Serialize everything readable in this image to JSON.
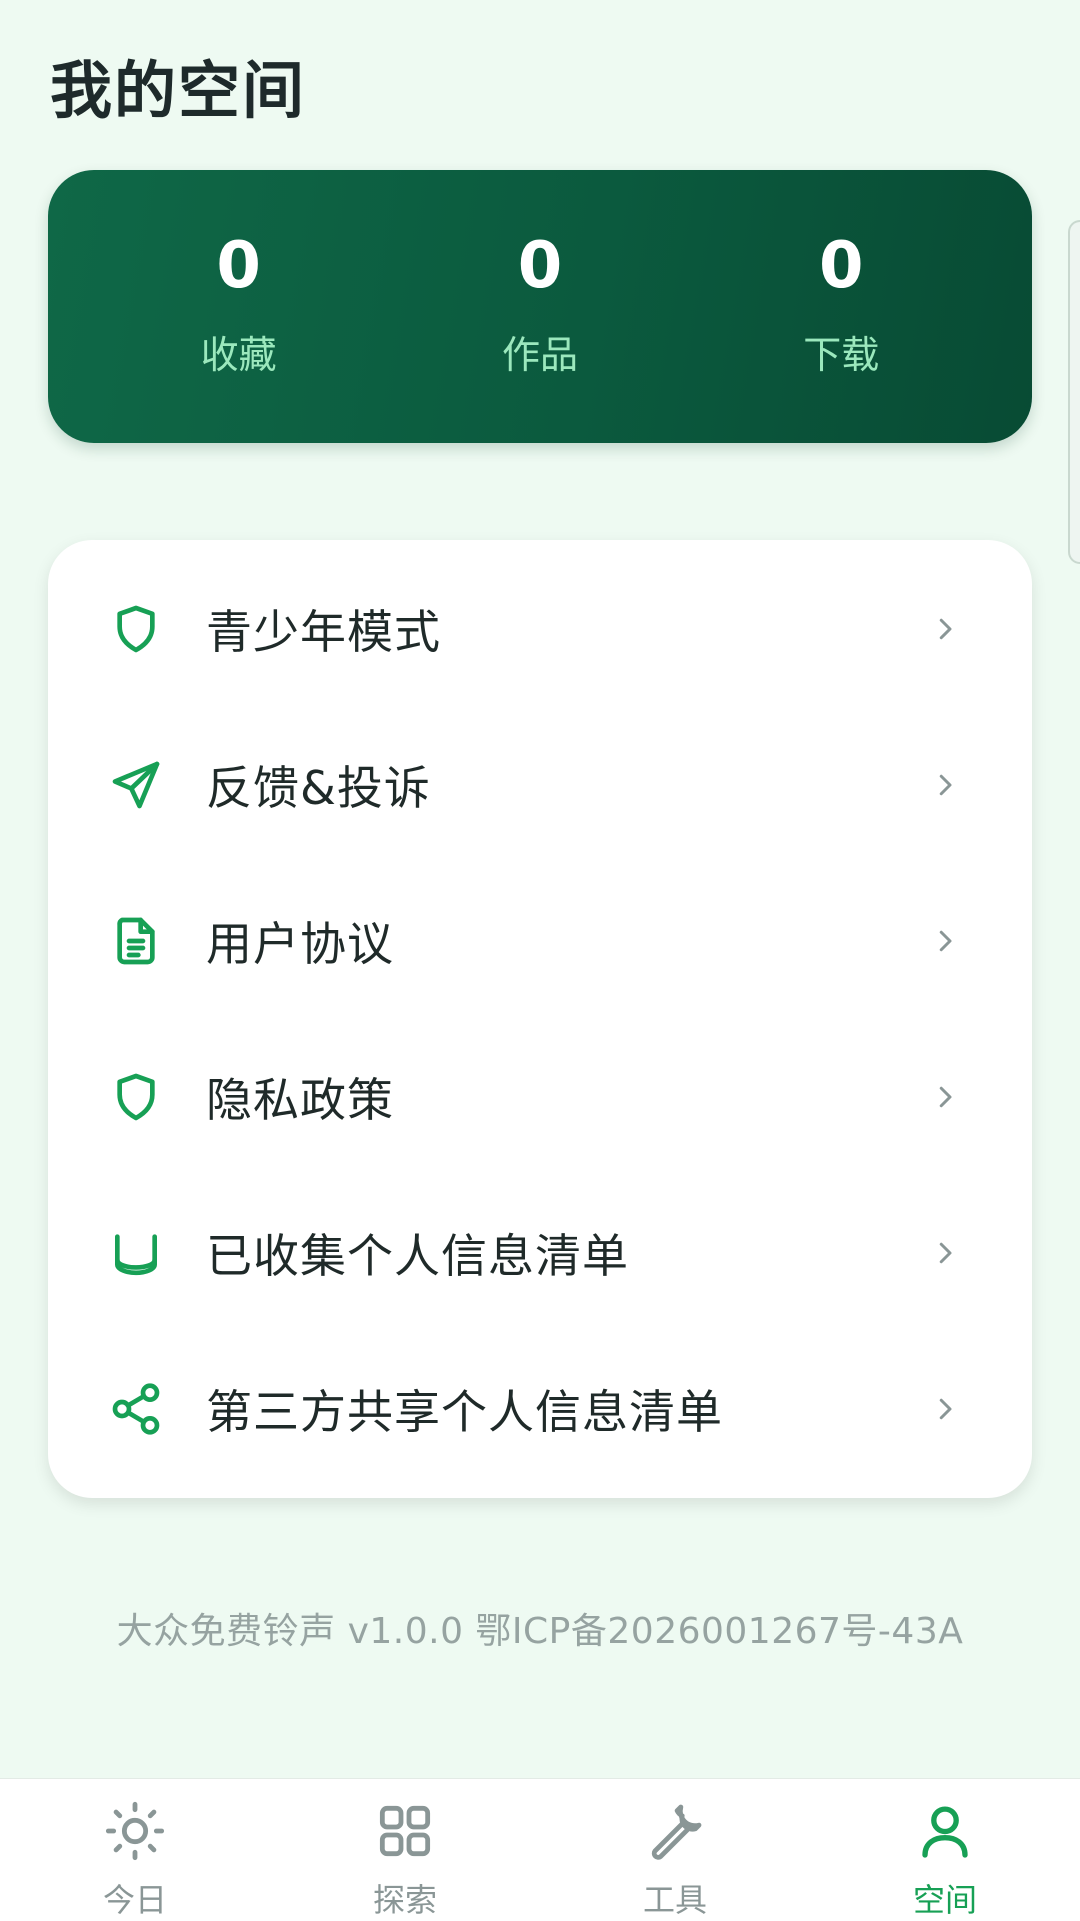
{
  "page": {
    "title": "我的空间"
  },
  "stats": [
    {
      "value": "0",
      "label": "收藏"
    },
    {
      "value": "0",
      "label": "作品"
    },
    {
      "value": "0",
      "label": "下载"
    }
  ],
  "menu": {
    "items": [
      {
        "label": "青少年模式",
        "icon": "shield-icon"
      },
      {
        "label": "反馈&投诉",
        "icon": "send-icon"
      },
      {
        "label": "用户协议",
        "icon": "document-icon"
      },
      {
        "label": "隐私政策",
        "icon": "shield-icon"
      },
      {
        "label": "已收集个人信息清单",
        "icon": "database-icon"
      },
      {
        "label": "第三方共享个人信息清单",
        "icon": "share-icon"
      }
    ]
  },
  "footer": {
    "text": "大众免费铃声 v1.0.0 鄂ICP备2026001267号-43A"
  },
  "nav": {
    "items": [
      {
        "label": "今日",
        "icon": "sun-icon",
        "active": false
      },
      {
        "label": "探索",
        "icon": "grid-icon",
        "active": false
      },
      {
        "label": "工具",
        "icon": "wrench-icon",
        "active": false
      },
      {
        "label": "空间",
        "icon": "user-icon",
        "active": true
      }
    ]
  },
  "colors": {
    "accent": "#17a055",
    "card_dark": "#0b5a3e",
    "stat_label": "#9be8bd",
    "background": "#eefaf2",
    "inactive": "#8a9696"
  }
}
